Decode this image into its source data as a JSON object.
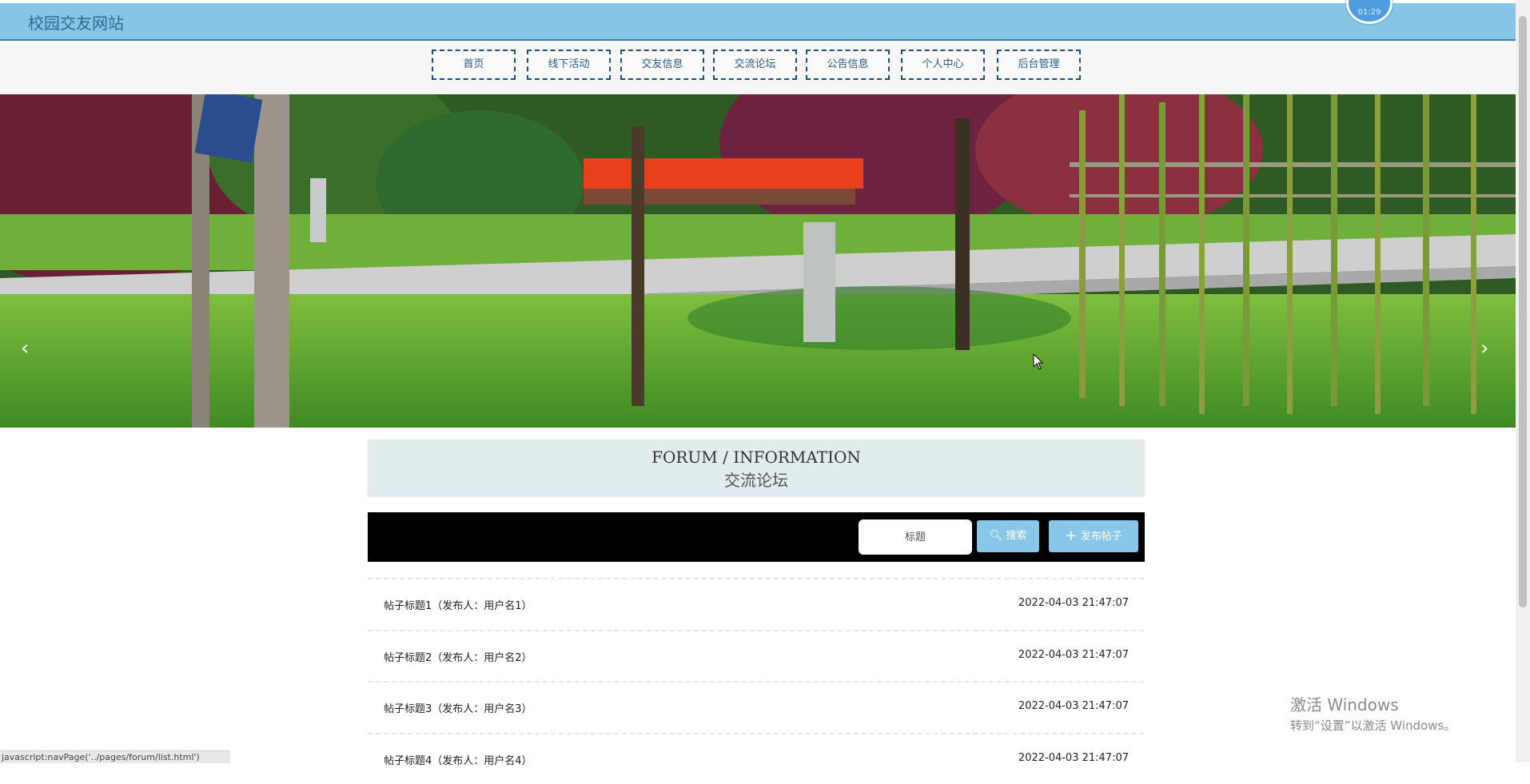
{
  "header": {
    "site_title": "校园交友网站",
    "clock": "01:29"
  },
  "nav": {
    "items": [
      "首页",
      "线下活动",
      "交友信息",
      "交流论坛",
      "公告信息",
      "个人中心",
      "后台管理"
    ]
  },
  "banner": {
    "prev": "‹",
    "next": "›",
    "slides": 3,
    "active_slide": 1
  },
  "forum": {
    "title_en": "FORUM / INFORMATION",
    "title_cn": "交流论坛"
  },
  "search": {
    "placeholder": "标题",
    "search_label": "搜索",
    "post_label": "发布帖子"
  },
  "posts": [
    {
      "title": "帖子标题1（发布人：用户名1）",
      "time": "2022-04-03 21:47:07"
    },
    {
      "title": "帖子标题2（发布人：用户名2）",
      "time": "2022-04-03 21:47:07"
    },
    {
      "title": "帖子标题3（发布人：用户名3）",
      "time": "2022-04-03 21:47:07"
    },
    {
      "title": "帖子标题4（发布人：用户名4）",
      "time": "2022-04-03 21:47:07"
    }
  ],
  "status": {
    "url": "javascript:navPage('../pages/forum/list.html')"
  },
  "watermark": {
    "line1": "激活 Windows",
    "line2": "转到“设置”以激活 Windows。"
  },
  "colors": {
    "topbar": "#87c5e6",
    "nav_border": "#1d4d83",
    "button": "#88c7e9",
    "dot_active": "#1e88c8"
  }
}
